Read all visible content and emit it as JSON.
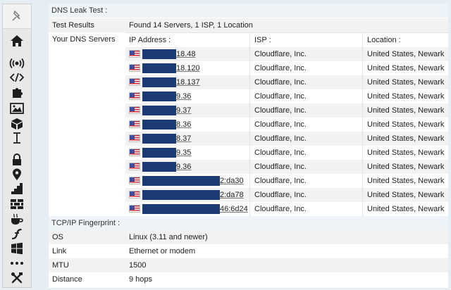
{
  "sidebar": {
    "icons": [
      "pin-icon",
      "home-icon",
      "broadcast-icon",
      "code-icon",
      "puzzle-icon",
      "image-icon",
      "cube-icon",
      "text-cursor-icon",
      "lock-icon",
      "location-pin-icon",
      "stairs-icon",
      "brick-wall-icon",
      "coffee-cup-icon",
      "flash-icon",
      "windows-icon",
      "more-icon",
      "tools-icon"
    ]
  },
  "dns_leak": {
    "heading": "DNS Leak Test :",
    "results_label": "Test Results",
    "results_value": "Found 14 Servers, 1 ISP, 1 Location",
    "servers_label": "Your DNS Servers",
    "col_ip": "IP Address :",
    "col_isp": "ISP :",
    "col_location": "Location :",
    "servers": [
      {
        "ip_tail": "18.48",
        "isp": "Cloudflare, Inc.",
        "location": "United States, Newark"
      },
      {
        "ip_tail": "18.120",
        "isp": "Cloudflare, Inc.",
        "location": "United States, Newark"
      },
      {
        "ip_tail": "18.137",
        "isp": "Cloudflare, Inc.",
        "location": "United States, Newark"
      },
      {
        "ip_tail": "9.36",
        "isp": "Cloudflare, Inc.",
        "location": "United States, Newark"
      },
      {
        "ip_tail": "9.37",
        "isp": "Cloudflare, Inc.",
        "location": "United States, Newark"
      },
      {
        "ip_tail": "8.36",
        "isp": "Cloudflare, Inc.",
        "location": "United States, Newark"
      },
      {
        "ip_tail": "8.37",
        "isp": "Cloudflare, Inc.",
        "location": "United States, Newark"
      },
      {
        "ip_tail": "9.35",
        "isp": "Cloudflare, Inc.",
        "location": "United States, Newark"
      },
      {
        "ip_tail": "9.36",
        "isp": "Cloudflare, Inc.",
        "location": "United States, Newark"
      },
      {
        "ip_tail": "2:da30",
        "isp": "Cloudflare, Inc.",
        "location": "United States, Newark"
      },
      {
        "ip_tail": "2:da78",
        "isp": "Cloudflare, Inc.",
        "location": "United States, Newark"
      },
      {
        "ip_tail": "46:6d24",
        "isp": "Cloudflare, Inc.",
        "location": "United States, Newark"
      }
    ]
  },
  "fingerprint": {
    "heading": "TCP/IP Fingerprint :",
    "rows": [
      {
        "label": "OS",
        "value": "Linux (3.11 and newer)"
      },
      {
        "label": "Link",
        "value": "Ethernet or modem"
      },
      {
        "label": "MTU",
        "value": "1500"
      },
      {
        "label": "Distance",
        "value": "9 hops"
      }
    ]
  }
}
